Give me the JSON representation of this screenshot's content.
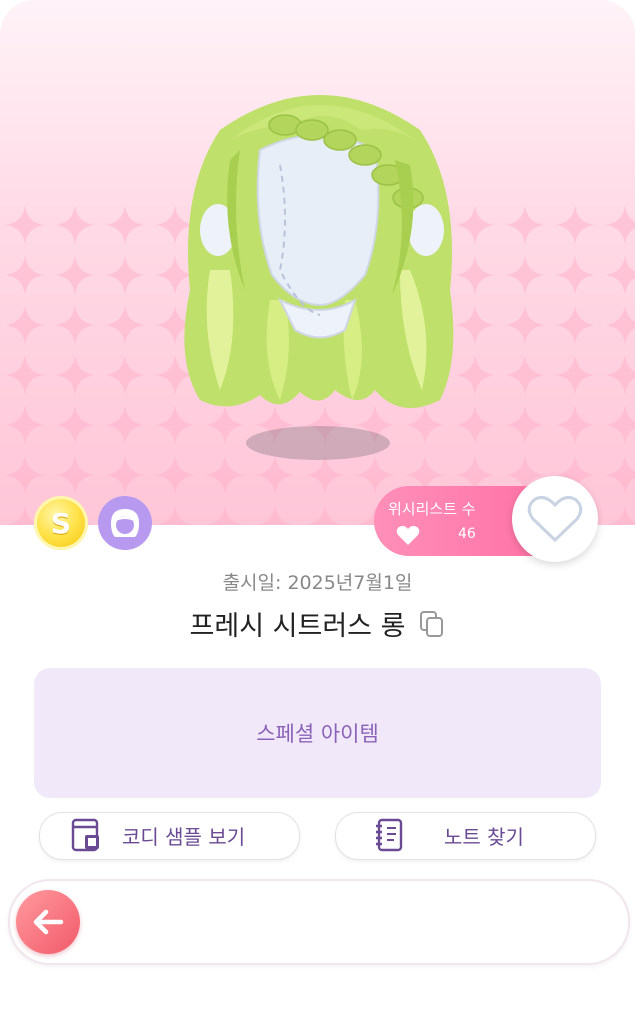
{
  "item": {
    "release_date": "출시일: 2025년7월1일",
    "name": "프레시 시트러스 롱",
    "category_label": "스페셜 아이템"
  },
  "badges": {
    "coin_letter": "S",
    "coin_icon": "s-coin-icon",
    "hair_icon": "hair-category-icon"
  },
  "wishlist": {
    "label": "위시리스트 수",
    "count": "46"
  },
  "buttons": {
    "coordi_sample": "코디 샘플 보기",
    "find_note": "노트 찾기"
  },
  "colors": {
    "banner_pink": "#ffc6d8",
    "wish_pink": "#ff6fa3",
    "special_bg": "#f1e9fa",
    "special_text": "#8a62b8",
    "back_button": "#f25a6a",
    "hair_green": "#b9dd5e"
  }
}
